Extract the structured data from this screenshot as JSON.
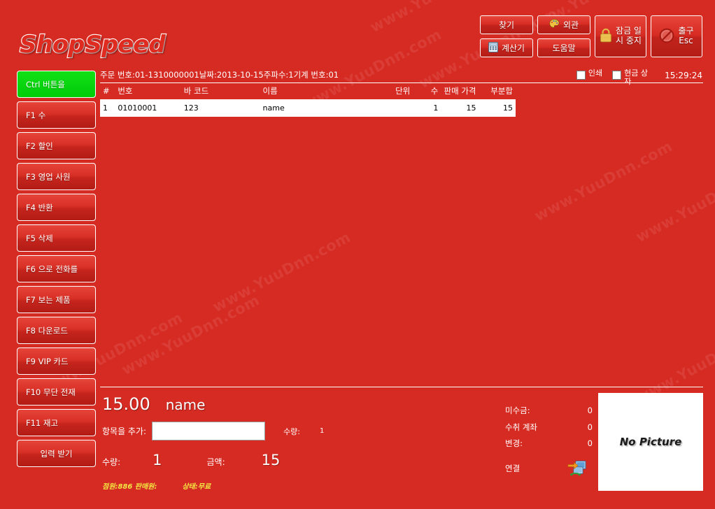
{
  "app": {
    "logo_part1": "Shop",
    "logo_part2": "Speed",
    "background_color": "#d62b22",
    "accent_active_color": "#00cc08",
    "status_text_color": "#f2e642",
    "watermark_text": "www.YuuDnn.com"
  },
  "toolbar": {
    "find_label": "찾기",
    "calculator_label": "계산기",
    "appearance_label": "외관",
    "help_label": "도움말",
    "lock_label": "잠금 일\n시 중지",
    "lock_label_line1": "잠금 일",
    "lock_label_line2": "시 중지",
    "exit_label_line1": "출구",
    "exit_label_line2": "Esc",
    "icons": {
      "calculator": "calculator-icon",
      "appearance": "palette-icon",
      "lock": "padlock-icon",
      "exit": "no-entry-icon"
    }
  },
  "options": {
    "print_label": "인쇄",
    "print_checked": false,
    "cashbox_label": "현금 상자",
    "cashbox_label_line1": "현금 상",
    "cashbox_label_line2": "자",
    "cashbox_checked": false,
    "clock": "15:29:24"
  },
  "sidebar": {
    "items": [
      {
        "label": "Ctrl 버튼을",
        "active": true,
        "center": false
      },
      {
        "label": "F1 수",
        "active": false,
        "center": false
      },
      {
        "label": "F2 할인",
        "active": false,
        "center": false
      },
      {
        "label": "F3 영업 사원",
        "active": false,
        "center": false
      },
      {
        "label": "F4 반환",
        "active": false,
        "center": false
      },
      {
        "label": "F5 삭제",
        "active": false,
        "center": false
      },
      {
        "label": "F6 으로 전화를",
        "active": false,
        "center": false
      },
      {
        "label": "F7 보는 제품",
        "active": false,
        "center": false
      },
      {
        "label": "F8 다운로드",
        "active": false,
        "center": false
      },
      {
        "label": "F9 VIP 카드",
        "active": false,
        "center": false
      },
      {
        "label": "F10 무단 전재",
        "active": false,
        "center": false
      },
      {
        "label": "F11 재고",
        "active": false,
        "center": false
      },
      {
        "label": "입력 받기",
        "active": false,
        "center": true
      }
    ]
  },
  "order": {
    "info_line": "주문 번호:01-1310000001날짜:2013-10-15주파수:1기계 번호:01",
    "order_no_label": "주문 번호",
    "order_no": "01-1310000001",
    "date_label": "날짜",
    "date": "2013-10-15",
    "frequency_label": "주파수",
    "frequency": "1",
    "machine_label": "기계 번호",
    "machine_no": "01"
  },
  "grid": {
    "columns": [
      {
        "key": "idx",
        "label": "#"
      },
      {
        "key": "code",
        "label": "번호"
      },
      {
        "key": "bar",
        "label": "바 코드"
      },
      {
        "key": "name",
        "label": "이름"
      },
      {
        "key": "unit",
        "label": "단위"
      },
      {
        "key": "qty",
        "label": "수"
      },
      {
        "key": "price",
        "label": "판매 가격"
      },
      {
        "key": "sub",
        "label": "부분합"
      }
    ],
    "rows": [
      {
        "idx": "1",
        "code": "01010001",
        "bar": "123",
        "name": "name",
        "unit": "",
        "qty": "1",
        "price": "15",
        "sub": "15"
      }
    ]
  },
  "detail": {
    "price": "15.00",
    "name": "name",
    "add_item_label": "항목을 추가:",
    "add_item_value": "",
    "add_item_placeholder": "",
    "add_qty_label": "수량:",
    "add_qty_value": "1",
    "qty_label": "수량:",
    "qty_value": "1",
    "amount_label": "금액:",
    "amount_value": "15",
    "clerk_text": "점원:886 판매원:",
    "state_text": "상태:무료"
  },
  "summary": {
    "rows": [
      {
        "label": "미수금:",
        "value": "0"
      },
      {
        "label": "수취 계좌",
        "value": "0"
      },
      {
        "label": "변경:",
        "value": "0"
      }
    ],
    "connection_label": "연결",
    "connection_icon": "network-connect-icon"
  },
  "picture": {
    "placeholder": "No Picture"
  }
}
